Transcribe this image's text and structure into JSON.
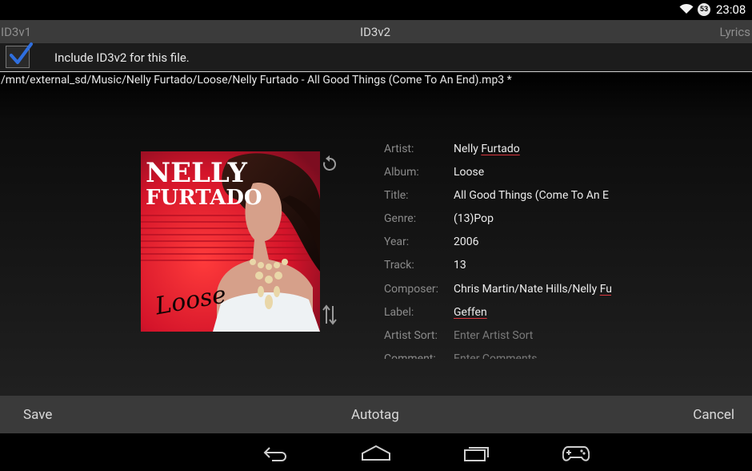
{
  "status_bar": {
    "battery": "53",
    "clock": "23:08"
  },
  "tabs": {
    "id3v1": "ID3v1",
    "id3v2": "ID3v2",
    "lyrics": "Lyrics"
  },
  "include": {
    "checked": true,
    "label": "Include ID3v2 for this file."
  },
  "file_path": "/mnt/external_sd/Music/Nelly Furtado/Loose/Nelly Furtado - All Good Things (Come To An End).mp3 *",
  "album_art": {
    "artist_text_1": "NELLY",
    "artist_text_2": "FURTADO",
    "album_text": "Loose"
  },
  "fields": [
    {
      "label": "Artist:",
      "value_a": "Nelly ",
      "value_b": "Furtado"
    },
    {
      "label": "Album:",
      "value": "Loose"
    },
    {
      "label": "Title:",
      "value": "All Good Things (Come To An E"
    },
    {
      "label": "Genre:",
      "value": "(13)Pop"
    },
    {
      "label": "Year:",
      "value": "2006"
    },
    {
      "label": "Track:",
      "value": "13"
    },
    {
      "label": "Composer:",
      "value_a": "Chris Martin/Nate Hills/Nelly ",
      "value_b": "Fu"
    },
    {
      "label": "Label:",
      "value_b": "Geffen"
    },
    {
      "label": "Artist Sort:",
      "placeholder": "Enter Artist Sort"
    },
    {
      "label": "Comment:",
      "placeholder": "Enter Comments"
    }
  ],
  "actions": {
    "save": "Save",
    "autotag": "Autotag",
    "cancel": "Cancel"
  },
  "colors": {
    "accent_check": "#2f6fe0",
    "spell_underline": "#d9363e"
  },
  "icons": [
    "wifi-icon",
    "battery-icon",
    "rotate-icon",
    "swap-icon",
    "back-icon",
    "home-icon",
    "recents-icon",
    "gamepad-icon"
  ]
}
